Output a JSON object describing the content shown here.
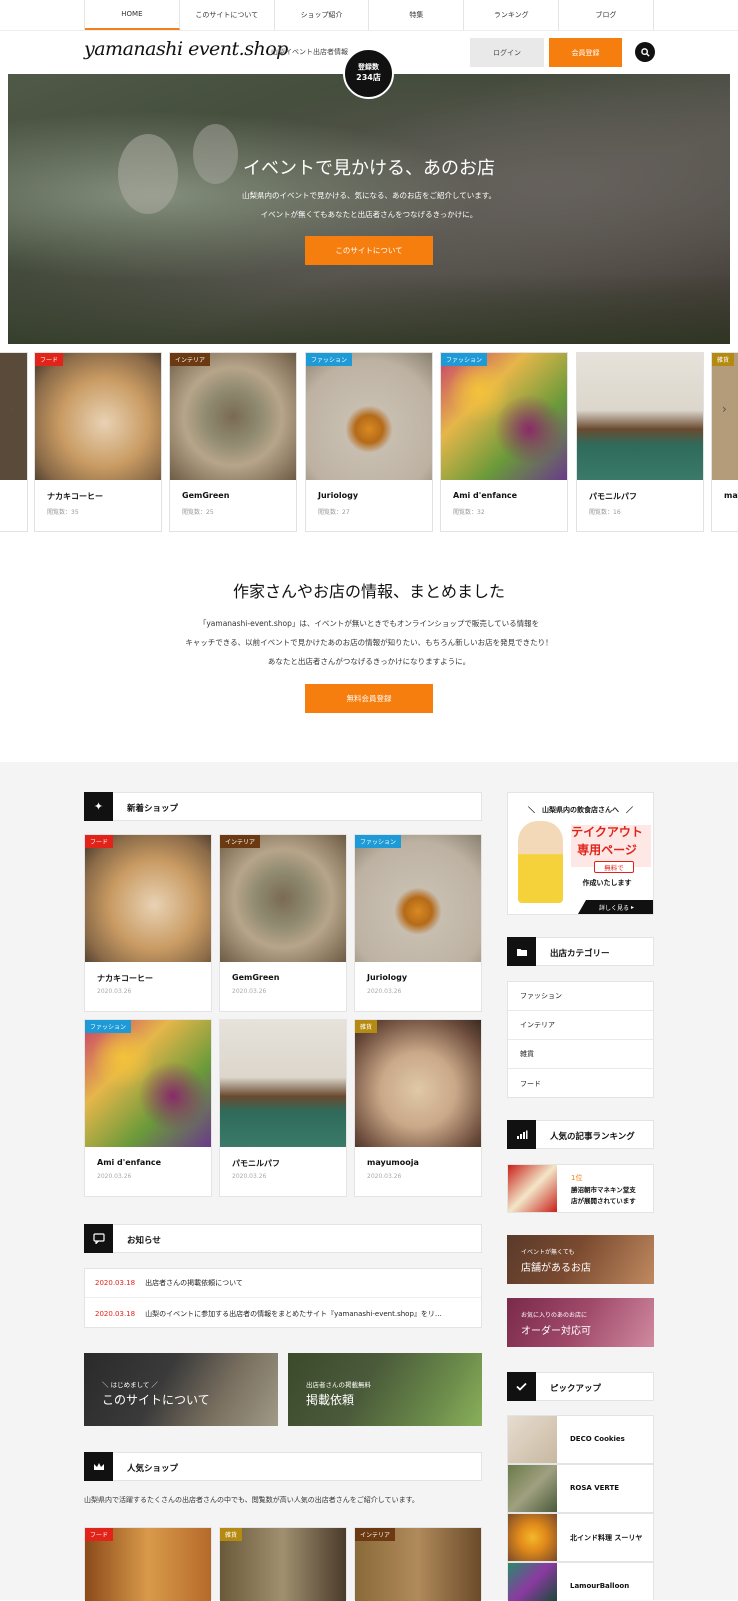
{
  "nav": [
    "HOME",
    "このサイトについて",
    "ショップ紹介",
    "特集",
    "ランキング",
    "ブログ"
  ],
  "header": {
    "logo": "yamanashi event.shop",
    "tagline": "山梨イベント出店者情報",
    "login": "ログイン",
    "signup": "会員登録",
    "badge_line1": "登録数",
    "badge_line2": "234店"
  },
  "hero": {
    "title": "イベントで見かける、あのお店",
    "sub1": "山梨県内のイベントで見かける、気になる、あのお店をご紹介しています。",
    "sub2": "イベントが無くてもあなたと出店者さんをつなげるきっかけに。",
    "cta": "このサイトについて"
  },
  "carousel": [
    {
      "tag": "フード",
      "tag_color": "#e2231a",
      "name": "ナカキコーヒー",
      "views": "閲覧数：35"
    },
    {
      "tag": "インテリア",
      "tag_color": "#6b3a12",
      "name": "GemGreen",
      "views": "閲覧数：25"
    },
    {
      "tag": "ファッション",
      "tag_color": "#1e9ad6",
      "name": "Juriology",
      "views": "閲覧数：27"
    },
    {
      "tag": "ファッション",
      "tag_color": "#1e9ad6",
      "name": "Ami d'enfance",
      "views": "閲覧数：32"
    },
    {
      "tag": "",
      "tag_color": "#1e9ad6",
      "name": "パモニルパフ",
      "views": "閲覧数：16"
    },
    {
      "tag": "雑貨",
      "tag_color": "#b58a12",
      "name": "may",
      "views": ""
    }
  ],
  "intro": {
    "title": "作家さんやお店の情報、まとめました",
    "p1": "「yamanashi-event.shop」は、イベントが無いときでもオンラインショップで販売している情報を",
    "p2": "キャッチできる、以前イベントで見かけたあのお店の情報が知りたい、もちろん新しいお店を発見できたり！",
    "p3": "あなたと出店者さんがつなげるきっかけになりますように。",
    "cta": "無料会員登録"
  },
  "new_shops": {
    "title": "新着ショップ",
    "items": [
      {
        "tag": "フード",
        "tag_color": "#e2231a",
        "name": "ナカキコーヒー",
        "date": "2020.03.26"
      },
      {
        "tag": "インテリア",
        "tag_color": "#6b3a12",
        "name": "GemGreen",
        "date": "2020.03.26"
      },
      {
        "tag": "ファッション",
        "tag_color": "#1e9ad6",
        "name": "Juriology",
        "date": "2020.03.26"
      },
      {
        "tag": "ファッション",
        "tag_color": "#1e9ad6",
        "name": "Ami d'enfance",
        "date": "2020.03.26"
      },
      {
        "tag": "",
        "tag_color": "#1e9ad6",
        "name": "パモニルパフ",
        "date": "2020.03.26"
      },
      {
        "tag": "雑貨",
        "tag_color": "#b58a12",
        "name": "mayumooja",
        "date": "2020.03.26"
      }
    ]
  },
  "news": {
    "title": "お知らせ",
    "items": [
      {
        "date": "2020.03.18",
        "text": "出店者さんの掲載依頼について"
      },
      {
        "date": "2020.03.18",
        "text": "山梨のイベントに参加する出店者の情報をまとめたサイト『yamanashi-event.shop』をリ…"
      }
    ]
  },
  "banners": [
    {
      "small": "＼ はじめまして ／",
      "large": "このサイトについて"
    },
    {
      "small": "出店者さんの掲載無料",
      "large": "掲載依頼"
    }
  ],
  "popular": {
    "title": "人気ショップ",
    "desc": "山梨県内で活躍するたくさんの出店者さんの中でも、閲覧数が高い人気の出店者さんをご紹介しています。",
    "tags": [
      {
        "tag": "フード",
        "tag_color": "#e2231a"
      },
      {
        "tag": "雑貨",
        "tag_color": "#b58a12"
      },
      {
        "tag": "インテリア",
        "tag_color": "#6b3a12"
      }
    ]
  },
  "sidebar": {
    "takeout": {
      "top": "＼　山梨県内の飲食店さんへ　／",
      "main1": "テイクアウト",
      "main2": "専用ページ",
      "free": "無料で",
      "create": "作成いたします",
      "more": "詳しく見る"
    },
    "categories_title": "出店カテゴリー",
    "categories": [
      "ファッション",
      "インテリア",
      "雑貨",
      "フード"
    ],
    "ranking_title": "人気の記事ランキング",
    "ranking": {
      "rank": "1位",
      "text1": "勝沼朝市マネキン堂支",
      "text2": "店が展開されています"
    },
    "banner1": {
      "small": "イベントが無くても",
      "large": "店舗があるお店"
    },
    "banner2": {
      "small": "お気に入りのあのお店に",
      "large": "オーダー対応可"
    },
    "pickup_title": "ピックアップ",
    "pickup": [
      "DECO Cookies",
      "ROSA VERTE",
      "北インド料理 スーリヤ",
      "LamourBalloon"
    ]
  },
  "colors": {
    "accent": "#f67e0e",
    "dark": "#111111",
    "food": "#e2231a",
    "fashion": "#1e9ad6",
    "interior": "#6b3a12",
    "zakka": "#b58a12"
  }
}
